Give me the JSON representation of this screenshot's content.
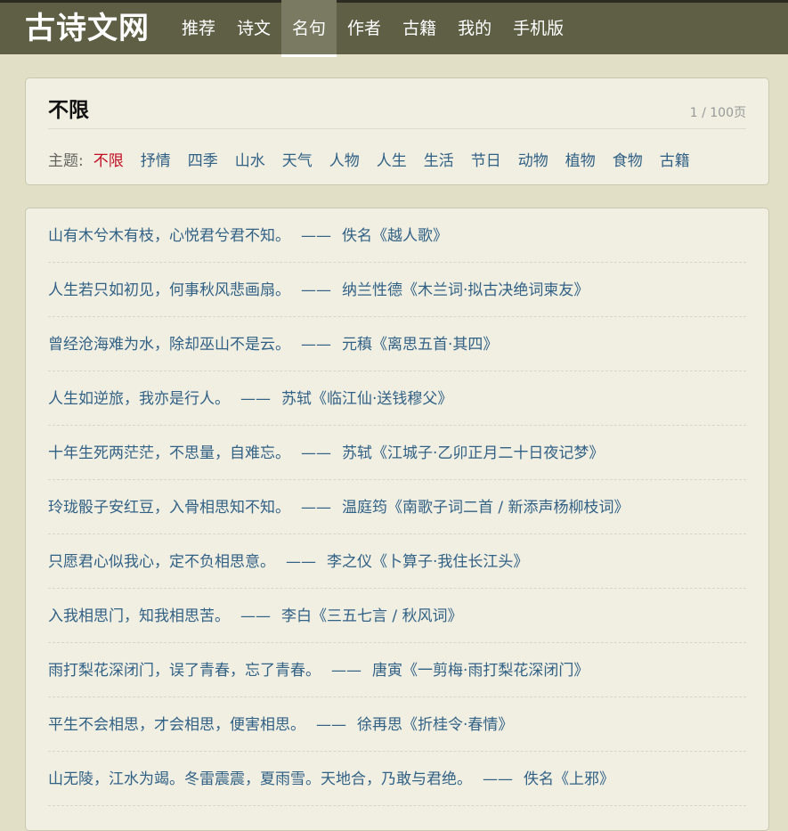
{
  "site": {
    "logo": "古诗文网"
  },
  "nav": {
    "items": [
      {
        "label": "推荐"
      },
      {
        "label": "诗文"
      },
      {
        "label": "名句"
      },
      {
        "label": "作者"
      },
      {
        "label": "古籍"
      },
      {
        "label": "我的"
      },
      {
        "label": "手机版"
      }
    ],
    "active": "名句"
  },
  "filter": {
    "title": "不限",
    "page_count": "1 / 100页",
    "theme_label": "主题:",
    "themes": [
      "不限",
      "抒情",
      "四季",
      "山水",
      "天气",
      "人物",
      "人生",
      "生活",
      "节日",
      "动物",
      "植物",
      "食物",
      "古籍"
    ],
    "active_theme": "不限"
  },
  "quotes": [
    {
      "text": "山有木兮木有枝，心悦君兮君不知。",
      "sep": "——",
      "source": "佚名《越人歌》"
    },
    {
      "text": "人生若只如初见，何事秋风悲画扇。",
      "sep": "——",
      "source": "纳兰性德《木兰词·拟古决绝词柬友》"
    },
    {
      "text": "曾经沧海难为水，除却巫山不是云。",
      "sep": "——",
      "source": "元稹《离思五首·其四》"
    },
    {
      "text": "人生如逆旅，我亦是行人。",
      "sep": "——",
      "source": "苏轼《临江仙·送钱穆父》"
    },
    {
      "text": "十年生死两茫茫，不思量，自难忘。",
      "sep": "——",
      "source": "苏轼《江城子·乙卯正月二十日夜记梦》"
    },
    {
      "text": "玲珑骰子安红豆，入骨相思知不知。",
      "sep": "——",
      "source": "温庭筠《南歌子词二首 / 新添声杨柳枝词》"
    },
    {
      "text": "只愿君心似我心，定不负相思意。",
      "sep": "——",
      "source": "李之仪《卜算子·我住长江头》"
    },
    {
      "text": "入我相思门，知我相思苦。",
      "sep": "——",
      "source": "李白《三五七言 / 秋风词》"
    },
    {
      "text": "雨打梨花深闭门，误了青春，忘了青春。",
      "sep": "——",
      "source": "唐寅《一剪梅·雨打梨花深闭门》"
    },
    {
      "text": "平生不会相思，才会相思，便害相思。",
      "sep": "——",
      "source": "徐再思《折桂令·春情》"
    },
    {
      "text": "山无陵，江水为竭。冬雷震震，夏雨雪。天地合，乃敢与君绝。",
      "sep": "——",
      "source": "佚名《上邪》"
    }
  ],
  "colors": {
    "header_bg": "#5e5f45",
    "page_bg": "#e1e0c7",
    "card_bg": "#f0efe2",
    "link": "#326186",
    "active_theme": "#c30d23"
  }
}
